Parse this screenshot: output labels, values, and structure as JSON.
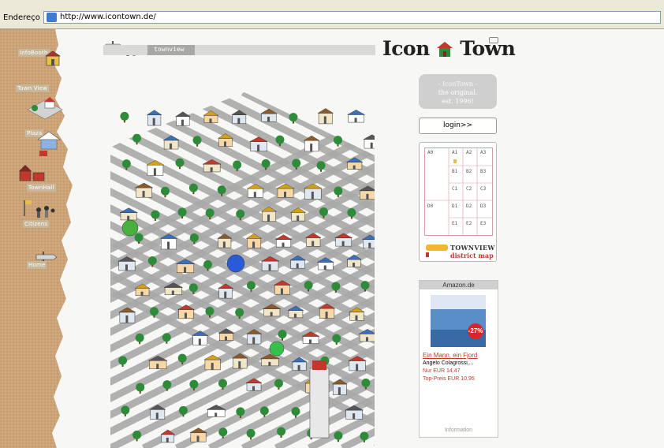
{
  "browser": {
    "address_label": "Endereço",
    "url": "http://www.icontown.de/"
  },
  "sidebar": {
    "items": [
      {
        "label": "InfoBooth",
        "icon": "info-booth-icon"
      },
      {
        "label": "Town View",
        "icon": "town-view-icon"
      },
      {
        "label": "Plaza",
        "icon": "plaza-icon"
      },
      {
        "label": "TownHall",
        "icon": "town-hall-icon"
      },
      {
        "label": "Citizens",
        "icon": "citizens-icon"
      },
      {
        "label": "Home",
        "icon": "home-icon"
      }
    ]
  },
  "header": {
    "section_label": "townview",
    "logo_left": "Icon",
    "logo_right": "Town"
  },
  "info_panel": {
    "line1": "- IconTown -",
    "line2": "the original.",
    "line3": "est. 1996!"
  },
  "login": {
    "label": "login>>"
  },
  "district_map": {
    "cells": [
      "A0",
      "A1",
      "A2",
      "A3",
      "B1",
      "B2",
      "B3",
      "C1",
      "C2",
      "C3",
      "D0",
      "D1",
      "D2",
      "D3",
      "E1",
      "E2",
      "E3"
    ],
    "title": "TOWNVIEW",
    "subtitle": "district map"
  },
  "amazon": {
    "header": "Amazon.de",
    "discount": "-27%",
    "title": "Ein Mann, ein Fjord",
    "author": "Angelo Colagrossi,...",
    "price": "Nur EUR 14,47",
    "top_price": "Top-Preis EUR 10,95",
    "info": "Information"
  },
  "colors": {
    "road": "#a9a9a9",
    "grass": "#ffffff",
    "roof_red": "#c0392b",
    "tree_green": "#2e8b3a",
    "accent_red": "#c0392b",
    "paper": "#c9a478"
  }
}
